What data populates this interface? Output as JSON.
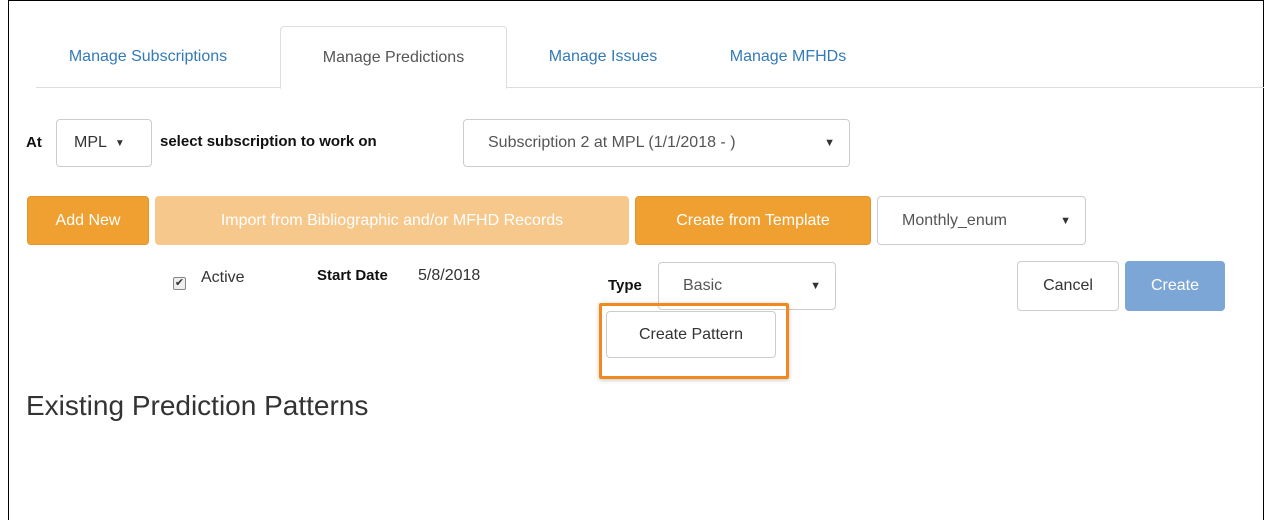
{
  "tabs": [
    {
      "label": "Manage Subscriptions",
      "active": false
    },
    {
      "label": "Manage Predictions",
      "active": true
    },
    {
      "label": "Manage Issues",
      "active": false
    },
    {
      "label": "Manage MFHDs",
      "active": false
    }
  ],
  "location": {
    "at_label": "At",
    "library_value": "MPL",
    "select_label": "select subscription to work on",
    "subscription_value": "Subscription 2 at MPL (1/1/2018 - )"
  },
  "actions": {
    "add_new": "Add New",
    "import": "Import from Bibliographic and/or MFHD Records",
    "create_from_template": "Create from Template",
    "template_value": "Monthly_enum"
  },
  "form": {
    "active_label": "Active",
    "active_checked": true,
    "start_date_label": "Start Date",
    "start_date_value": "5/8/2018",
    "type_label": "Type",
    "type_value": "Basic",
    "create_pattern": "Create Pattern",
    "cancel": "Cancel",
    "create": "Create"
  },
  "section": {
    "heading": "Existing Prediction Patterns"
  },
  "colors": {
    "accent_orange": "#f0a030",
    "highlight_orange": "#f08a1c",
    "primary_blue": "#7ca6d6",
    "link_blue": "#337ab7"
  }
}
